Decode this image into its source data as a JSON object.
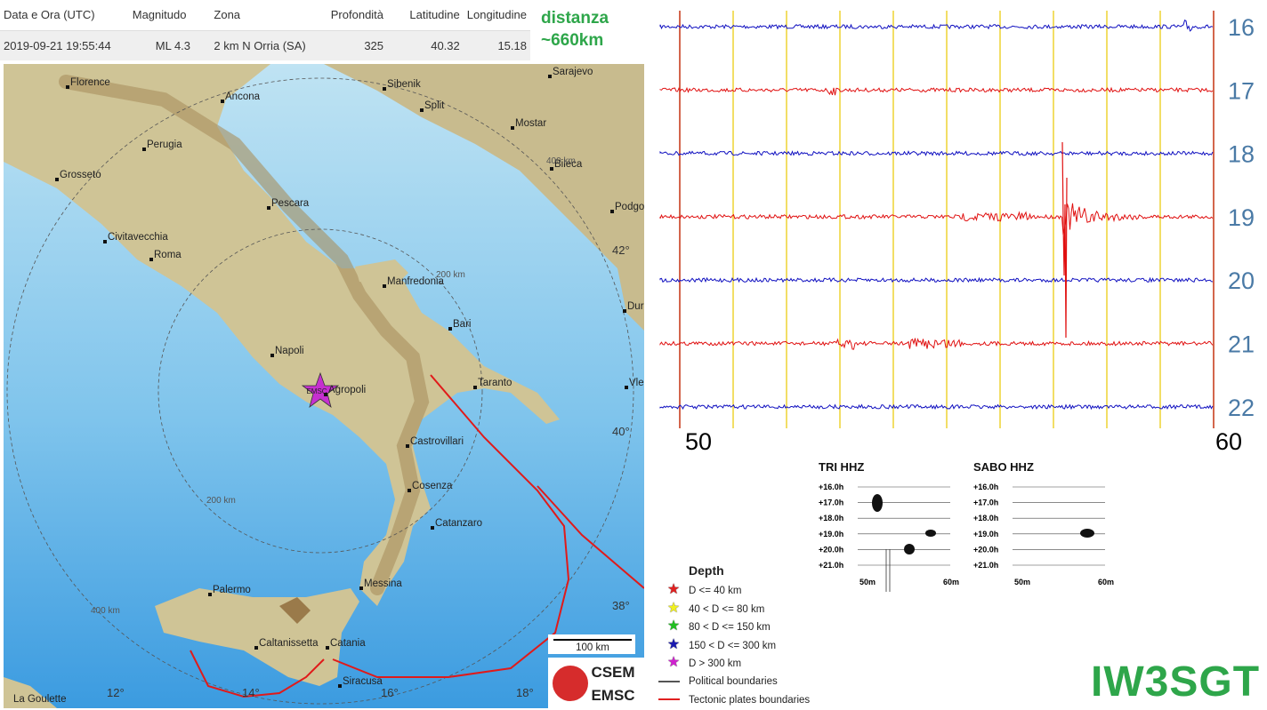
{
  "header": {
    "columns": [
      "Data e Ora (UTC)",
      "Magnitudo",
      "Zona",
      "Profondità",
      "Latitudine",
      "Longitudine"
    ],
    "row": [
      "2019-09-21 19:55:44",
      "ML 4.3",
      "2 km N Orria (SA)",
      "325",
      "40.32",
      "15.18"
    ]
  },
  "distance": {
    "line1": "distanza",
    "line2": "~660km"
  },
  "map": {
    "cities": [
      {
        "name": "Florence"
      },
      {
        "name": "Ancona"
      },
      {
        "name": "Perugia"
      },
      {
        "name": "Grosseto"
      },
      {
        "name": "Pescara"
      },
      {
        "name": "Civitavecchia"
      },
      {
        "name": "Roma"
      },
      {
        "name": "Manfredonia"
      },
      {
        "name": "Bari"
      },
      {
        "name": "Napoli"
      },
      {
        "name": "Agropoli"
      },
      {
        "name": "Taranto"
      },
      {
        "name": "Castrovillari"
      },
      {
        "name": "Cosenza"
      },
      {
        "name": "Catanzaro"
      },
      {
        "name": "Messina"
      },
      {
        "name": "Palermo"
      },
      {
        "name": "Caltanissetta"
      },
      {
        "name": "Catania"
      },
      {
        "name": "Siracusa"
      },
      {
        "name": "La Goulette"
      },
      {
        "name": "Sibenik"
      },
      {
        "name": "Split"
      },
      {
        "name": "Mostar"
      },
      {
        "name": "Sarajevo"
      },
      {
        "name": "Bileca"
      },
      {
        "name": "Podgo"
      },
      {
        "name": "Dur"
      },
      {
        "name": "Vle"
      }
    ],
    "distance_rings": [
      "200 km",
      "200 km",
      "400 km",
      "400 km"
    ],
    "lat_labels": [
      "42°",
      "40°",
      "38°"
    ],
    "lon_labels": [
      "12°",
      "14°",
      "16°",
      "18°"
    ],
    "epicenter_label": "EMSC",
    "scale_label": "100 km",
    "logo_top": "CSEM",
    "logo_bottom": "EMSC"
  },
  "seismogram": {
    "hour_labels": [
      "16",
      "17",
      "18",
      "19",
      "20",
      "21",
      "22"
    ],
    "minute_start": "50",
    "minute_end": "60",
    "trace_colors": [
      "#1010c0",
      "#e01010"
    ]
  },
  "mini_charts": [
    {
      "title": "TRI HHZ",
      "rows": [
        "+16.0h",
        "+17.0h",
        "+18.0h",
        "+19.0h",
        "+20.0h",
        "+21.0h"
      ],
      "x_start": "50m",
      "x_end": "60m"
    },
    {
      "title": "SABO HHZ",
      "rows": [
        "+16.0h",
        "+17.0h",
        "+18.0h",
        "+19.0h",
        "+20.0h",
        "+21.0h"
      ],
      "x_start": "50m",
      "x_end": "60m"
    }
  ],
  "legend": {
    "title": "Depth",
    "items": [
      {
        "label": "D <= 40 km",
        "color": "#e02020"
      },
      {
        "label": "40 < D <= 80 km",
        "color": "#f0f020"
      },
      {
        "label": "80 < D <= 150 km",
        "color": "#20c020"
      },
      {
        "label": "150 < D <= 300 km",
        "color": "#1a1ab0"
      },
      {
        "label": "D > 300 km",
        "color": "#d020d0"
      }
    ],
    "lines": [
      {
        "label": "Political boundaries",
        "color": "#555555"
      },
      {
        "label": "Tectonic plates boundaries",
        "color": "#e02020"
      }
    ]
  },
  "callsign": "IW3SGT"
}
